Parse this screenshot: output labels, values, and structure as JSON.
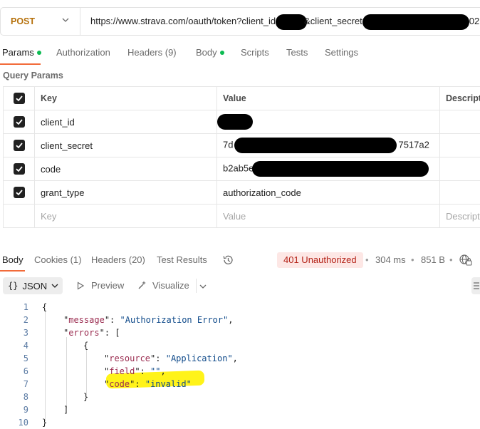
{
  "request": {
    "method": "POST",
    "url_parts": [
      "https://www.strava.com/oauth/token?client_id",
      "&client_secret",
      "02"
    ]
  },
  "request_tabs": [
    {
      "label": "Params",
      "dot": true
    },
    {
      "label": "Authorization"
    },
    {
      "label": "Headers (9)"
    },
    {
      "label": "Body",
      "dot": true
    },
    {
      "label": "Scripts"
    },
    {
      "label": "Tests"
    },
    {
      "label": "Settings"
    }
  ],
  "query_params": {
    "title": "Query Params",
    "columns": [
      "Key",
      "Value",
      "Descript"
    ],
    "rows": [
      {
        "key": "client_id",
        "value": ""
      },
      {
        "key": "client_secret",
        "value_start": "7d",
        "value_end": "7517a2"
      },
      {
        "key": "code",
        "value_start": "b2ab5e",
        "value_end": ""
      },
      {
        "key": "grant_type",
        "value": "authorization_code"
      }
    ],
    "placeholder": {
      "key": "Key",
      "value": "Value",
      "description": "Descript"
    }
  },
  "response_tabs": [
    {
      "label": "Body"
    },
    {
      "label": "Cookies (1)"
    },
    {
      "label": "Headers (20)"
    },
    {
      "label": "Test Results"
    }
  ],
  "response": {
    "status": "401 Unauthorized",
    "time": "304 ms",
    "size": "851 B",
    "format": "JSON",
    "preview": "Preview",
    "visualize": "Visualize"
  },
  "colors": {
    "accent": "#f26b3a",
    "status_error": "#b42318",
    "highlight": "#fff200"
  },
  "code_lines": [
    {
      "n": "1",
      "t": "{"
    },
    {
      "n": "2",
      "k": "message",
      "v": "Authorization Error",
      "indent": 1
    },
    {
      "n": "3",
      "k": "errors",
      "open": "[",
      "indent": 1
    },
    {
      "n": "4",
      "t": "{",
      "indent": 2
    },
    {
      "n": "5",
      "k": "resource",
      "v": "Application",
      "indent": 3
    },
    {
      "n": "6",
      "k": "field",
      "v": "",
      "indent": 3
    },
    {
      "n": "7",
      "k": "code",
      "v": "invalid",
      "indent": 3,
      "last": true
    },
    {
      "n": "8",
      "t": "}",
      "indent": 2
    },
    {
      "n": "9",
      "t": "]",
      "indent": 1
    },
    {
      "n": "10",
      "t": "}"
    }
  ]
}
